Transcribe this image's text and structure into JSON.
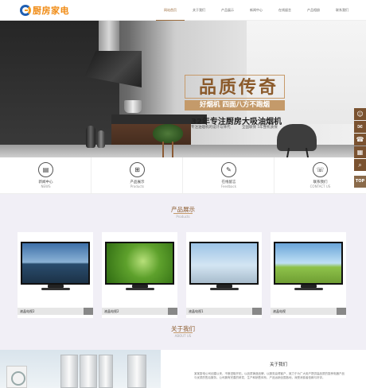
{
  "header": {
    "logo_text": "厨房家电",
    "nav": [
      "网站首页",
      "关于我们",
      "产品展示",
      "新闻中心",
      "在线留言",
      "产品相册",
      "联系我们"
    ]
  },
  "banner": {
    "slogan": "品质传奇",
    "sub_slogan": "好烟机 四面八方不跑烟",
    "feature_a": "32年专注厨房",
    "feature_a_sub": "专注油烟机的设计与体代",
    "feature_b": "大吸油烟机",
    "feature_b_sub": "全国联保 5年整机质保",
    "slide_count": 3,
    "active_slide": 2
  },
  "float_bar": {
    "icons": [
      "qq-icon",
      "wechat-icon",
      "phone-icon",
      "qrcode-icon",
      "search-icon"
    ],
    "top_label": "TOP"
  },
  "quick_links": [
    {
      "label": "新闻中心",
      "en": "NEWS",
      "icon": "news-icon"
    },
    {
      "label": "产品展示",
      "en": "Products",
      "icon": "grid-icon"
    },
    {
      "label": "在线留言",
      "en": "Feedback",
      "icon": "edit-icon"
    },
    {
      "label": "联系我们",
      "en": "CONTACT US",
      "icon": "phone-icon"
    }
  ],
  "products": {
    "title": "产品展示",
    "en": "Products",
    "items": [
      {
        "name": "液晶电视2"
      },
      {
        "name": "液晶电视2"
      },
      {
        "name": "液晶电视1"
      },
      {
        "name": "液晶电视"
      }
    ]
  },
  "about": {
    "title": "关于我们",
    "en": "ABOUT US",
    "panel_title": "关于我们",
    "text": "某某厨电公司创建以来，不断进取开拓，以品质铸造品牌，以服务赢得客户，致力于为广大用户提供高品质的厨房电器产品与优质的售后服务。公司拥有完善的研发、生产和销售体系，产品远销全国各地，深受消费者信赖与好评。"
  },
  "colors": {
    "accent": "#8b5a2b",
    "float_bar": "#7a5230",
    "section_bg": "#f1eff6"
  }
}
